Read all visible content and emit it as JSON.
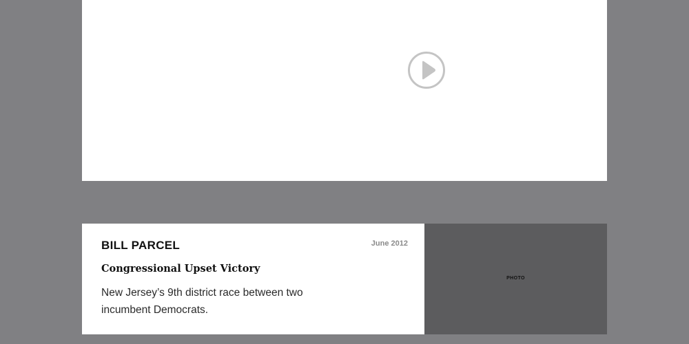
{
  "video": {
    "play_icon": "play-circle-icon",
    "accent_color": "#c4c4c4"
  },
  "card": {
    "name": "BILL PARCEL",
    "date": "June 2012",
    "headline": "Congressional Upset Victory",
    "description": "New Jersey’s 9th district race between two incumbent Democrats.",
    "photo_label": "PHOTO"
  },
  "colors": {
    "background": "#808083",
    "panel": "#ffffff",
    "photo_placeholder": "#5c5c5e"
  }
}
